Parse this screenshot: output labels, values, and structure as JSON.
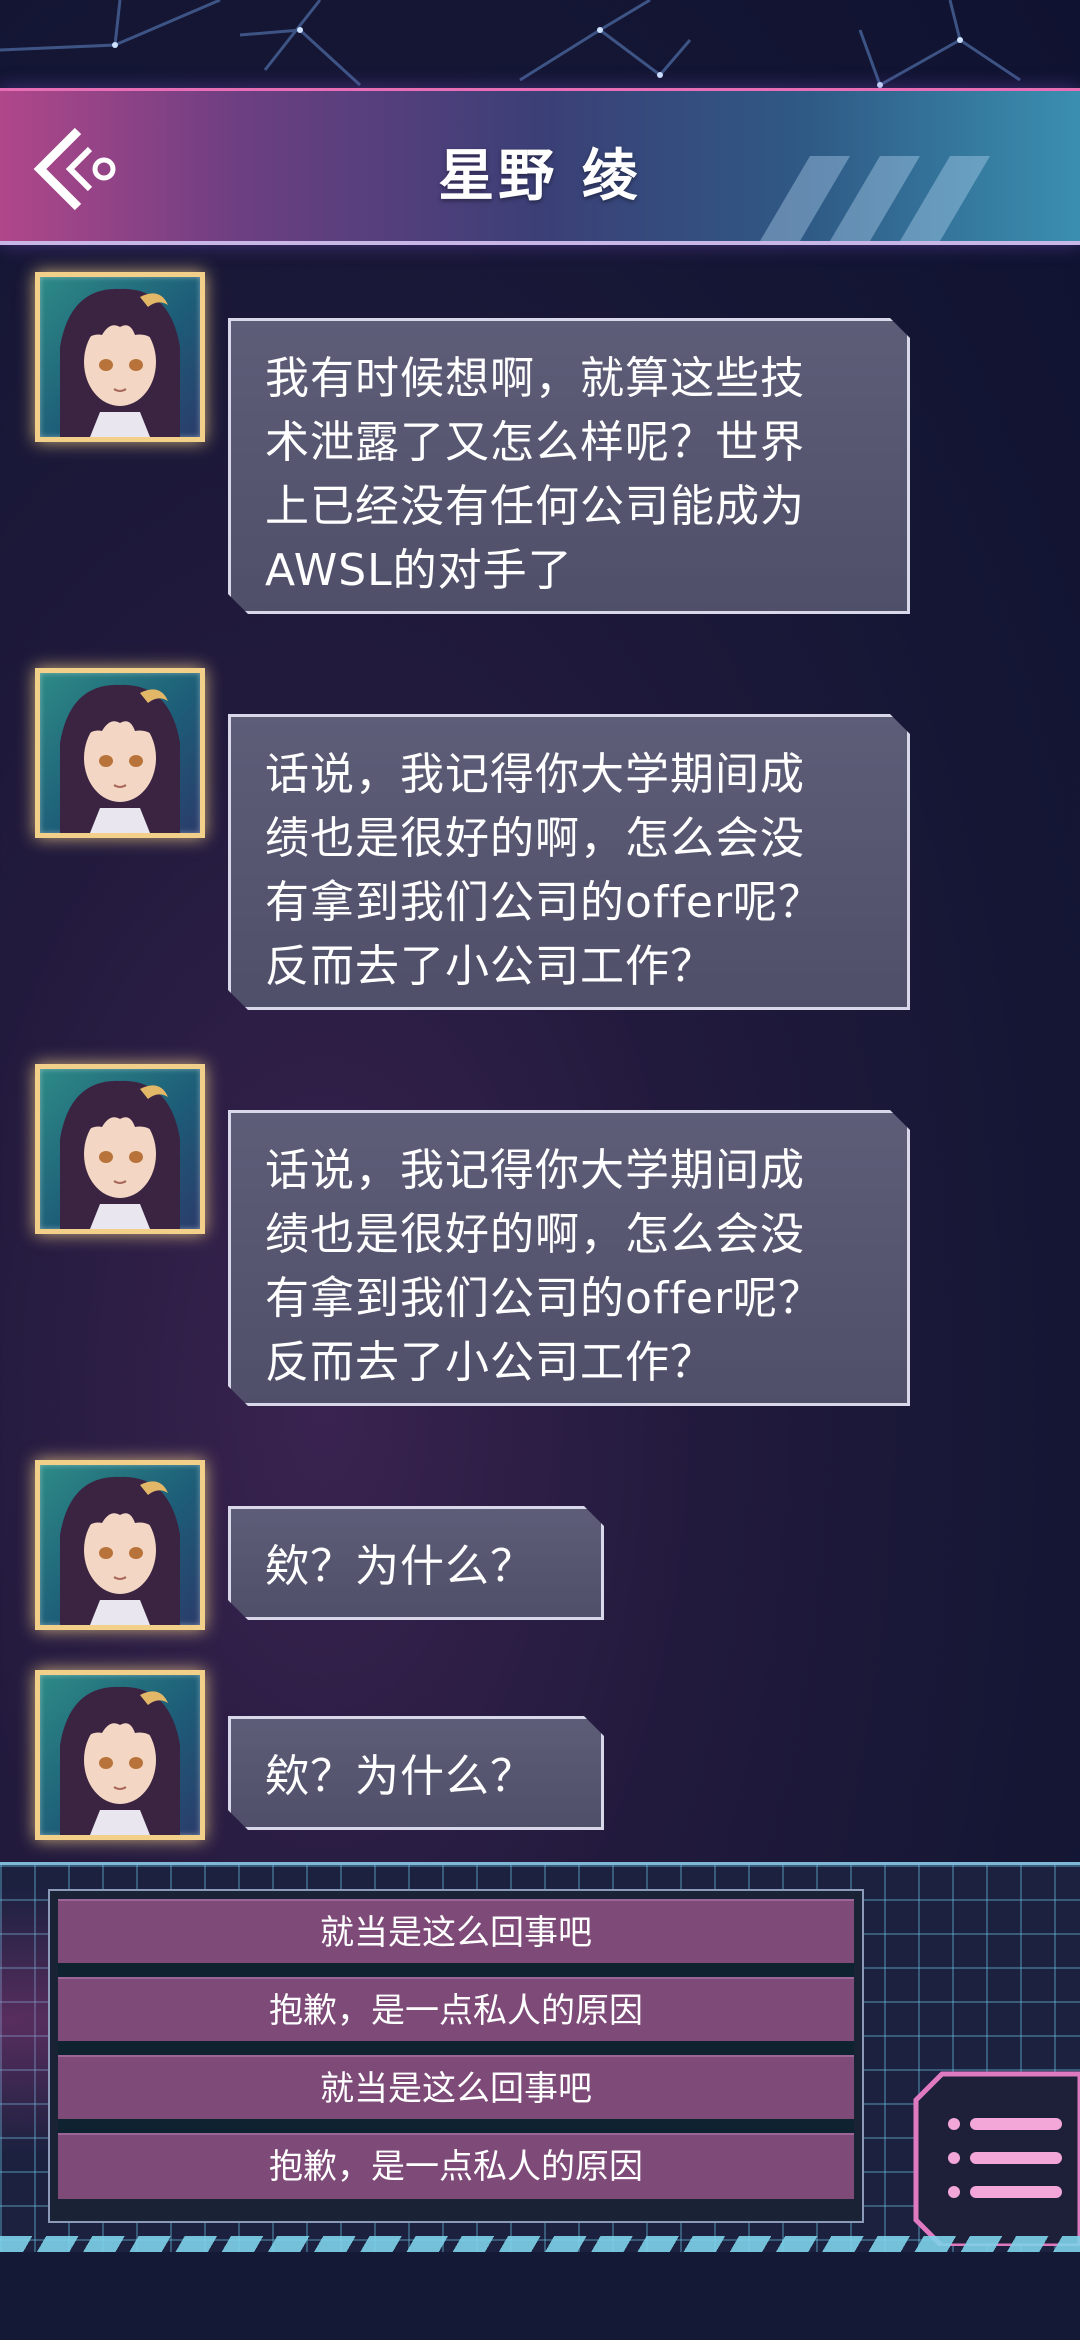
{
  "header": {
    "title": "星野 绫",
    "back_icon": "chevron-back-icon"
  },
  "messages": [
    {
      "avatar": "character-avatar",
      "text": "我有时候想啊，就算这些技\n术泄露了又怎么样呢？世界\n上已经没有任何公司能成为\nAWSL的对手了"
    },
    {
      "avatar": "character-avatar",
      "text": "话说，我记得你大学期间成\n绩也是很好的啊，怎么会没\n有拿到我们公司的offer呢？\n反而去了小公司工作？"
    },
    {
      "avatar": "character-avatar",
      "text": "话说，我记得你大学期间成\n绩也是很好的啊，怎么会没\n有拿到我们公司的offer呢？\n反而去了小公司工作？"
    },
    {
      "avatar": "character-avatar",
      "text": "欸？为什么？"
    },
    {
      "avatar": "character-avatar",
      "text": "欸？为什么？"
    }
  ],
  "choices": [
    "就当是这么回事吧",
    "抱歉，是一点私人的原因",
    "就当是这么回事吧",
    "抱歉，是一点私人的原因"
  ],
  "menu_icon": "menu-list-icon",
  "colors": {
    "header_pink": "#b0478a",
    "header_blue": "#3a8fb0",
    "bubble_bg": "#5d5d78",
    "choice_bg": "#7e4a78",
    "avatar_border": "#f3d089"
  }
}
